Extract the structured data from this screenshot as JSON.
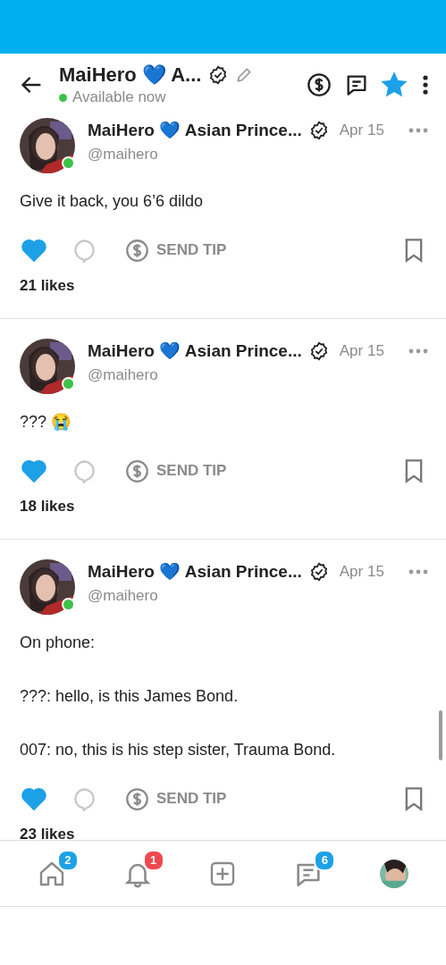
{
  "header": {
    "title": "MaiHero 💙 A...",
    "verified": true,
    "status": "Available now",
    "online": true,
    "favorite": true
  },
  "posts": [
    {
      "name": "MaiHero 💙 Asian Prince...",
      "handle": "@maihero",
      "date": "Apr 15",
      "online": true,
      "text": "Give it back, you 6’6 dildo",
      "liked": true,
      "tip": "SEND TIP",
      "likes": "21 likes"
    },
    {
      "name": "MaiHero 💙 Asian Prince...",
      "handle": "@maihero",
      "date": "Apr 15",
      "online": true,
      "text": "??? 😭",
      "liked": true,
      "tip": "SEND TIP",
      "likes": "18 likes"
    },
    {
      "name": "MaiHero 💙 Asian Prince...",
      "handle": "@maihero",
      "date": "Apr 15",
      "online": true,
      "text": "On phone:\n\n???: hello, is this James Bond.\n\n007: no, this is his step sister, Trauma Bond.",
      "liked": true,
      "tip": "SEND TIP",
      "likes": "23 likes"
    }
  ],
  "nav": [
    {
      "kind": "home",
      "badge": "2",
      "color": "#1da1e6"
    },
    {
      "kind": "bell",
      "badge": "1",
      "color": "#f0484f"
    },
    {
      "kind": "add"
    },
    {
      "kind": "messages",
      "badge": "6",
      "color": "#1da1e6"
    },
    {
      "kind": "avatar"
    }
  ]
}
